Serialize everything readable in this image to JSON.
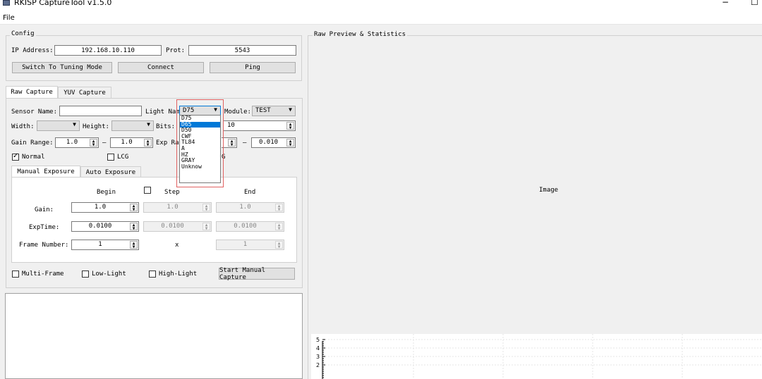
{
  "window": {
    "title": "RKISP CaptureTool v1.5.0",
    "minimize": "−",
    "maximize": "☐"
  },
  "menu": {
    "file": "File"
  },
  "config": {
    "title": "Config",
    "ip_label": "IP Address:",
    "ip_value": "192.168.10.110",
    "port_label": "Prot:",
    "port_value": "5543",
    "switch_button": "Switch To Tuning Mode",
    "connect_button": "Connect",
    "ping_button": "Ping"
  },
  "tabs": {
    "raw": "Raw Capture",
    "yuv": "YUV Capture"
  },
  "raw": {
    "sensor_label": "Sensor Name:",
    "light_label": "Light Name:",
    "light_value": "D75",
    "module_label": "Module:",
    "module_value": "TEST",
    "width_label": "Width:",
    "height_label": "Height:",
    "bits_label": "Bits:",
    "bits_value": "10",
    "gain_label": "Gain Range:",
    "gain_min": "1.0",
    "gain_max": "1.0",
    "dash": "–",
    "exp_label": "Exp Ra",
    "exp_max": "0.010",
    "normal_label": "Normal",
    "lcg_label": "LCG",
    "hcg_fragment": "G"
  },
  "light_options": [
    "D75",
    "D65",
    "D50",
    "CWF",
    "TL84",
    "A",
    "HZ",
    "GRAY",
    "Unknow"
  ],
  "exposure_tabs": {
    "manual": "Manual Exposure",
    "auto": "Auto Exposure"
  },
  "manual": {
    "begin_label": "Begin",
    "step_label": "Step",
    "end_label": "End",
    "gain_label": "Gain:",
    "gain_begin": "1.0",
    "gain_step": "1.0",
    "gain_end": "1.0",
    "exp_label": "ExpTime:",
    "exp_begin": "0.0100",
    "exp_step": "0.0100",
    "exp_end": "0.0100",
    "frame_label": "Frame Number:",
    "frame_begin": "1",
    "frame_x": "x",
    "frame_end": "1"
  },
  "bottom": {
    "multi_frame": "Multi-Frame",
    "low_light": "Low-Light",
    "high_light": "High-Light",
    "start_button": "Start Manual Capture"
  },
  "preview": {
    "title": "Raw Preview & Statistics",
    "image_label": "Image"
  },
  "chart_data": {
    "type": "line",
    "y_ticks": [
      "5",
      "4",
      "3",
      "2"
    ]
  }
}
